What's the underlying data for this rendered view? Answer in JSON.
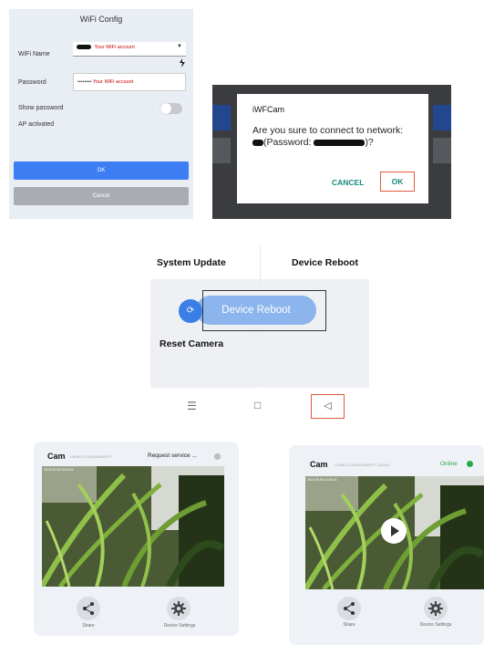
{
  "wifi_config": {
    "title": "WiFi Config",
    "wifi_name_label": "WiFi Name",
    "wifi_name_value": "Your WiFi account",
    "password_label": "Password",
    "password_mask": "••••••••",
    "password_value": "Your WiFi account",
    "show_password_label": "Show password",
    "ap_label": "AP activated",
    "ok_label": "OK",
    "cancel_label": "Cancel"
  },
  "dialog": {
    "title": "iWFCam",
    "message_part1": "Are you sure to connect to network:",
    "message_part2": "(Password:",
    "message_part3": ")?",
    "cancel_label": "CANCEL",
    "ok_label": "OK"
  },
  "system": {
    "system_update_label": "System Update",
    "device_reboot_title": "Device Reboot",
    "device_reboot_button": "Device Reboot",
    "reset_camera_label": "Reset Camera"
  },
  "nav": {
    "recent": "☰",
    "home": "□",
    "back": "◁"
  },
  "camera1": {
    "name": "Cam",
    "id": "LAHBCE-016054AB62FF",
    "status": "Request service ...",
    "share_label": "Share",
    "settings_label": "Device Settings",
    "timestamp": "2019-09-05 13:34:16"
  },
  "camera2": {
    "name": "Cam",
    "id": "LAHBCE-016054AB62FF-116304",
    "status": "Online",
    "share_label": "Share",
    "settings_label": "Device Settings",
    "timestamp": "2019-09-05 13:34:16"
  },
  "colors": {
    "primary_blue": "#3d7ef5",
    "teal_action": "#1a8a7c",
    "highlight_red": "#e05a3a",
    "online_green": "#27a845"
  }
}
